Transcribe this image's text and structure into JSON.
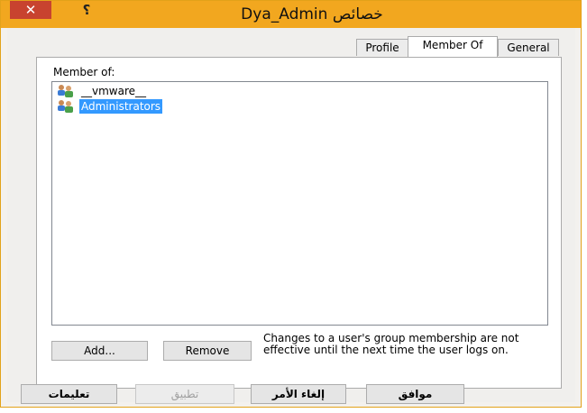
{
  "window": {
    "title": "خصائص Dya_Admin",
    "close_glyph": "✕",
    "help_glyph": "؟",
    "accent_color": "#f2a71f"
  },
  "tabs": [
    {
      "label": "Profile",
      "active": false
    },
    {
      "label": "Member Of",
      "active": true
    },
    {
      "label": "General",
      "active": false
    }
  ],
  "member_of": {
    "label": "Member of:",
    "groups": [
      {
        "name": "__vmware__",
        "selected": false,
        "icon": "group-icon"
      },
      {
        "name": "Administrators",
        "selected": true,
        "icon": "group-icon"
      }
    ],
    "add_label": "Add...",
    "remove_label": "Remove",
    "note": "Changes to a user's group membership are not effective until the next time the user logs on."
  },
  "footer": {
    "help_label": "تعليمات",
    "apply_label": "تطبيق",
    "cancel_label": "إلغاء الأمر",
    "ok_label": "موافق"
  }
}
